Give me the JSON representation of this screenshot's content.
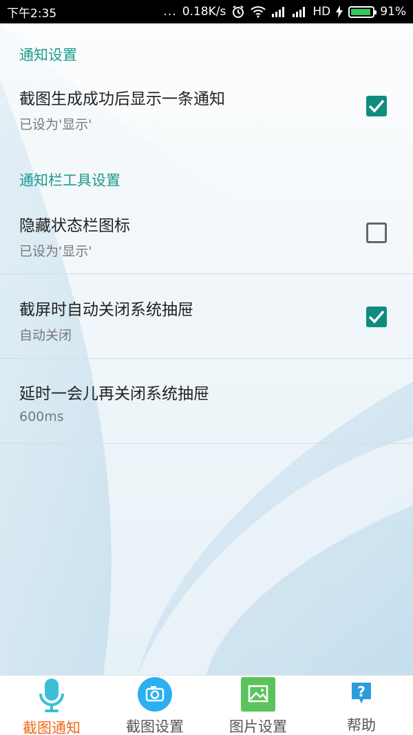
{
  "status_bar": {
    "time": "下午2:35",
    "dots": "...",
    "net_speed": "0.18K/s",
    "network_type": "HD",
    "battery_percent": "91%",
    "battery_level": 0.91,
    "icons": [
      "alarm-icon",
      "wifi-icon",
      "signal-icon",
      "signal-icon",
      "charging-icon",
      "battery-icon"
    ]
  },
  "sections": [
    {
      "header": "通知设置",
      "items": [
        {
          "title": "截图生成成功后显示一条通知",
          "subtitle": "已设为'显示'",
          "checked": true
        }
      ]
    },
    {
      "header": "通知栏工具设置",
      "items": [
        {
          "title": "隐藏状态栏图标",
          "subtitle": "已设为'显示'",
          "checked": false
        },
        {
          "title": "截屏时自动关闭系统抽屉",
          "subtitle": "自动关闭",
          "checked": true
        },
        {
          "title": "延时一会儿再关闭系统抽屉",
          "subtitle": "600ms"
        }
      ]
    }
  ],
  "bottom_nav": {
    "items": [
      {
        "label": "截图通知",
        "icon": "microphone-icon",
        "active": true
      },
      {
        "label": "截图设置",
        "icon": "camera-icon",
        "active": false
      },
      {
        "label": "图片设置",
        "icon": "image-icon",
        "active": false
      },
      {
        "label": "帮助",
        "icon": "help-icon",
        "active": false
      }
    ]
  },
  "colors": {
    "accent": "#1a9a8c",
    "checkbox": "#0f8c80",
    "active_nav": "#ee6a1a",
    "camera_circle": "#2ab0f0",
    "image_square": "#5cc35c",
    "help_blue": "#2d9cdb"
  }
}
